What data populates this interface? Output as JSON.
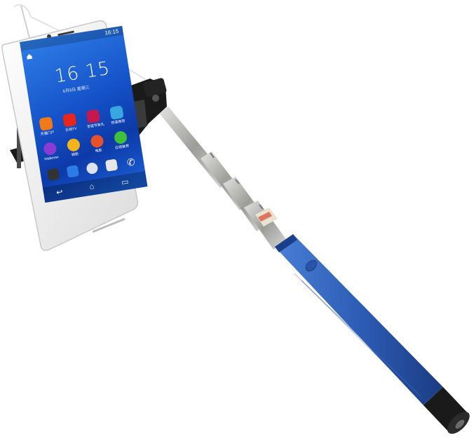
{
  "scene": {
    "subject": "selfie-stick",
    "colors": {
      "handle": "#2f5fb8",
      "handle_dark": "#1d3f86",
      "shaft": "#b9b9b6",
      "clamp": "#1a1a1a",
      "phone_body": "#f2f2f2"
    }
  },
  "phone": {
    "status_time": "16:15",
    "clock": "16 15",
    "date_line": "6月9日 星期三",
    "apps": [
      {
        "label": "天猫门户",
        "color": "#f07a1a",
        "icon": "shop-icon"
      },
      {
        "label": "乐视TV",
        "color": "#e6261f",
        "icon": "tv-icon"
      },
      {
        "label": "圣诞节有礼",
        "color": "#c4184f",
        "icon": "gift-icon"
      },
      {
        "label": "惊喜推荐",
        "color": "#38a7e0",
        "icon": "star-icon"
      },
      {
        "label": "Walkman",
        "color": "#8a3bd6",
        "icon": "music-icon"
      },
      {
        "label": "相册",
        "color": "#f4b21b",
        "icon": "photo-icon"
      },
      {
        "label": "电影",
        "color": "#e8522a",
        "icon": "movie-icon"
      },
      {
        "label": "应用推荐",
        "color": "#3fbf3a",
        "icon": "app-store-icon"
      }
    ],
    "dock": [
      {
        "icon": "camera-icon",
        "color": "#333333"
      },
      {
        "icon": "messages-icon",
        "color": "#2d7be5"
      },
      {
        "icon": "apps-icon",
        "color": "#ffffff"
      },
      {
        "icon": "contacts-icon",
        "color": "#e8e8e8"
      },
      {
        "icon": "phone-icon",
        "color": "#ffffff"
      }
    ]
  }
}
